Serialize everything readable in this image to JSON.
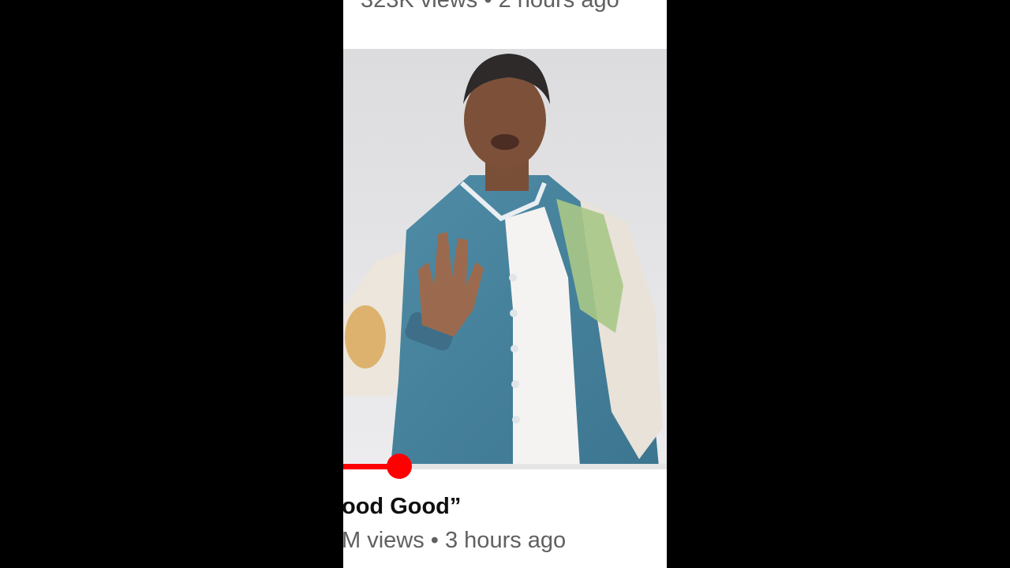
{
  "previous_item": {
    "meta": "323K views • 2 hours ago"
  },
  "video": {
    "thumbnail_desc": "thumbnail-man-in-teal-varsity-jacket",
    "title": "ood Good”",
    "meta": "M views • 3 hours ago",
    "progress_fraction": 0.173
  },
  "colors": {
    "background": "#000000",
    "surface": "#ffffff",
    "accent": "#ff0000",
    "secondary_text": "#606060"
  }
}
